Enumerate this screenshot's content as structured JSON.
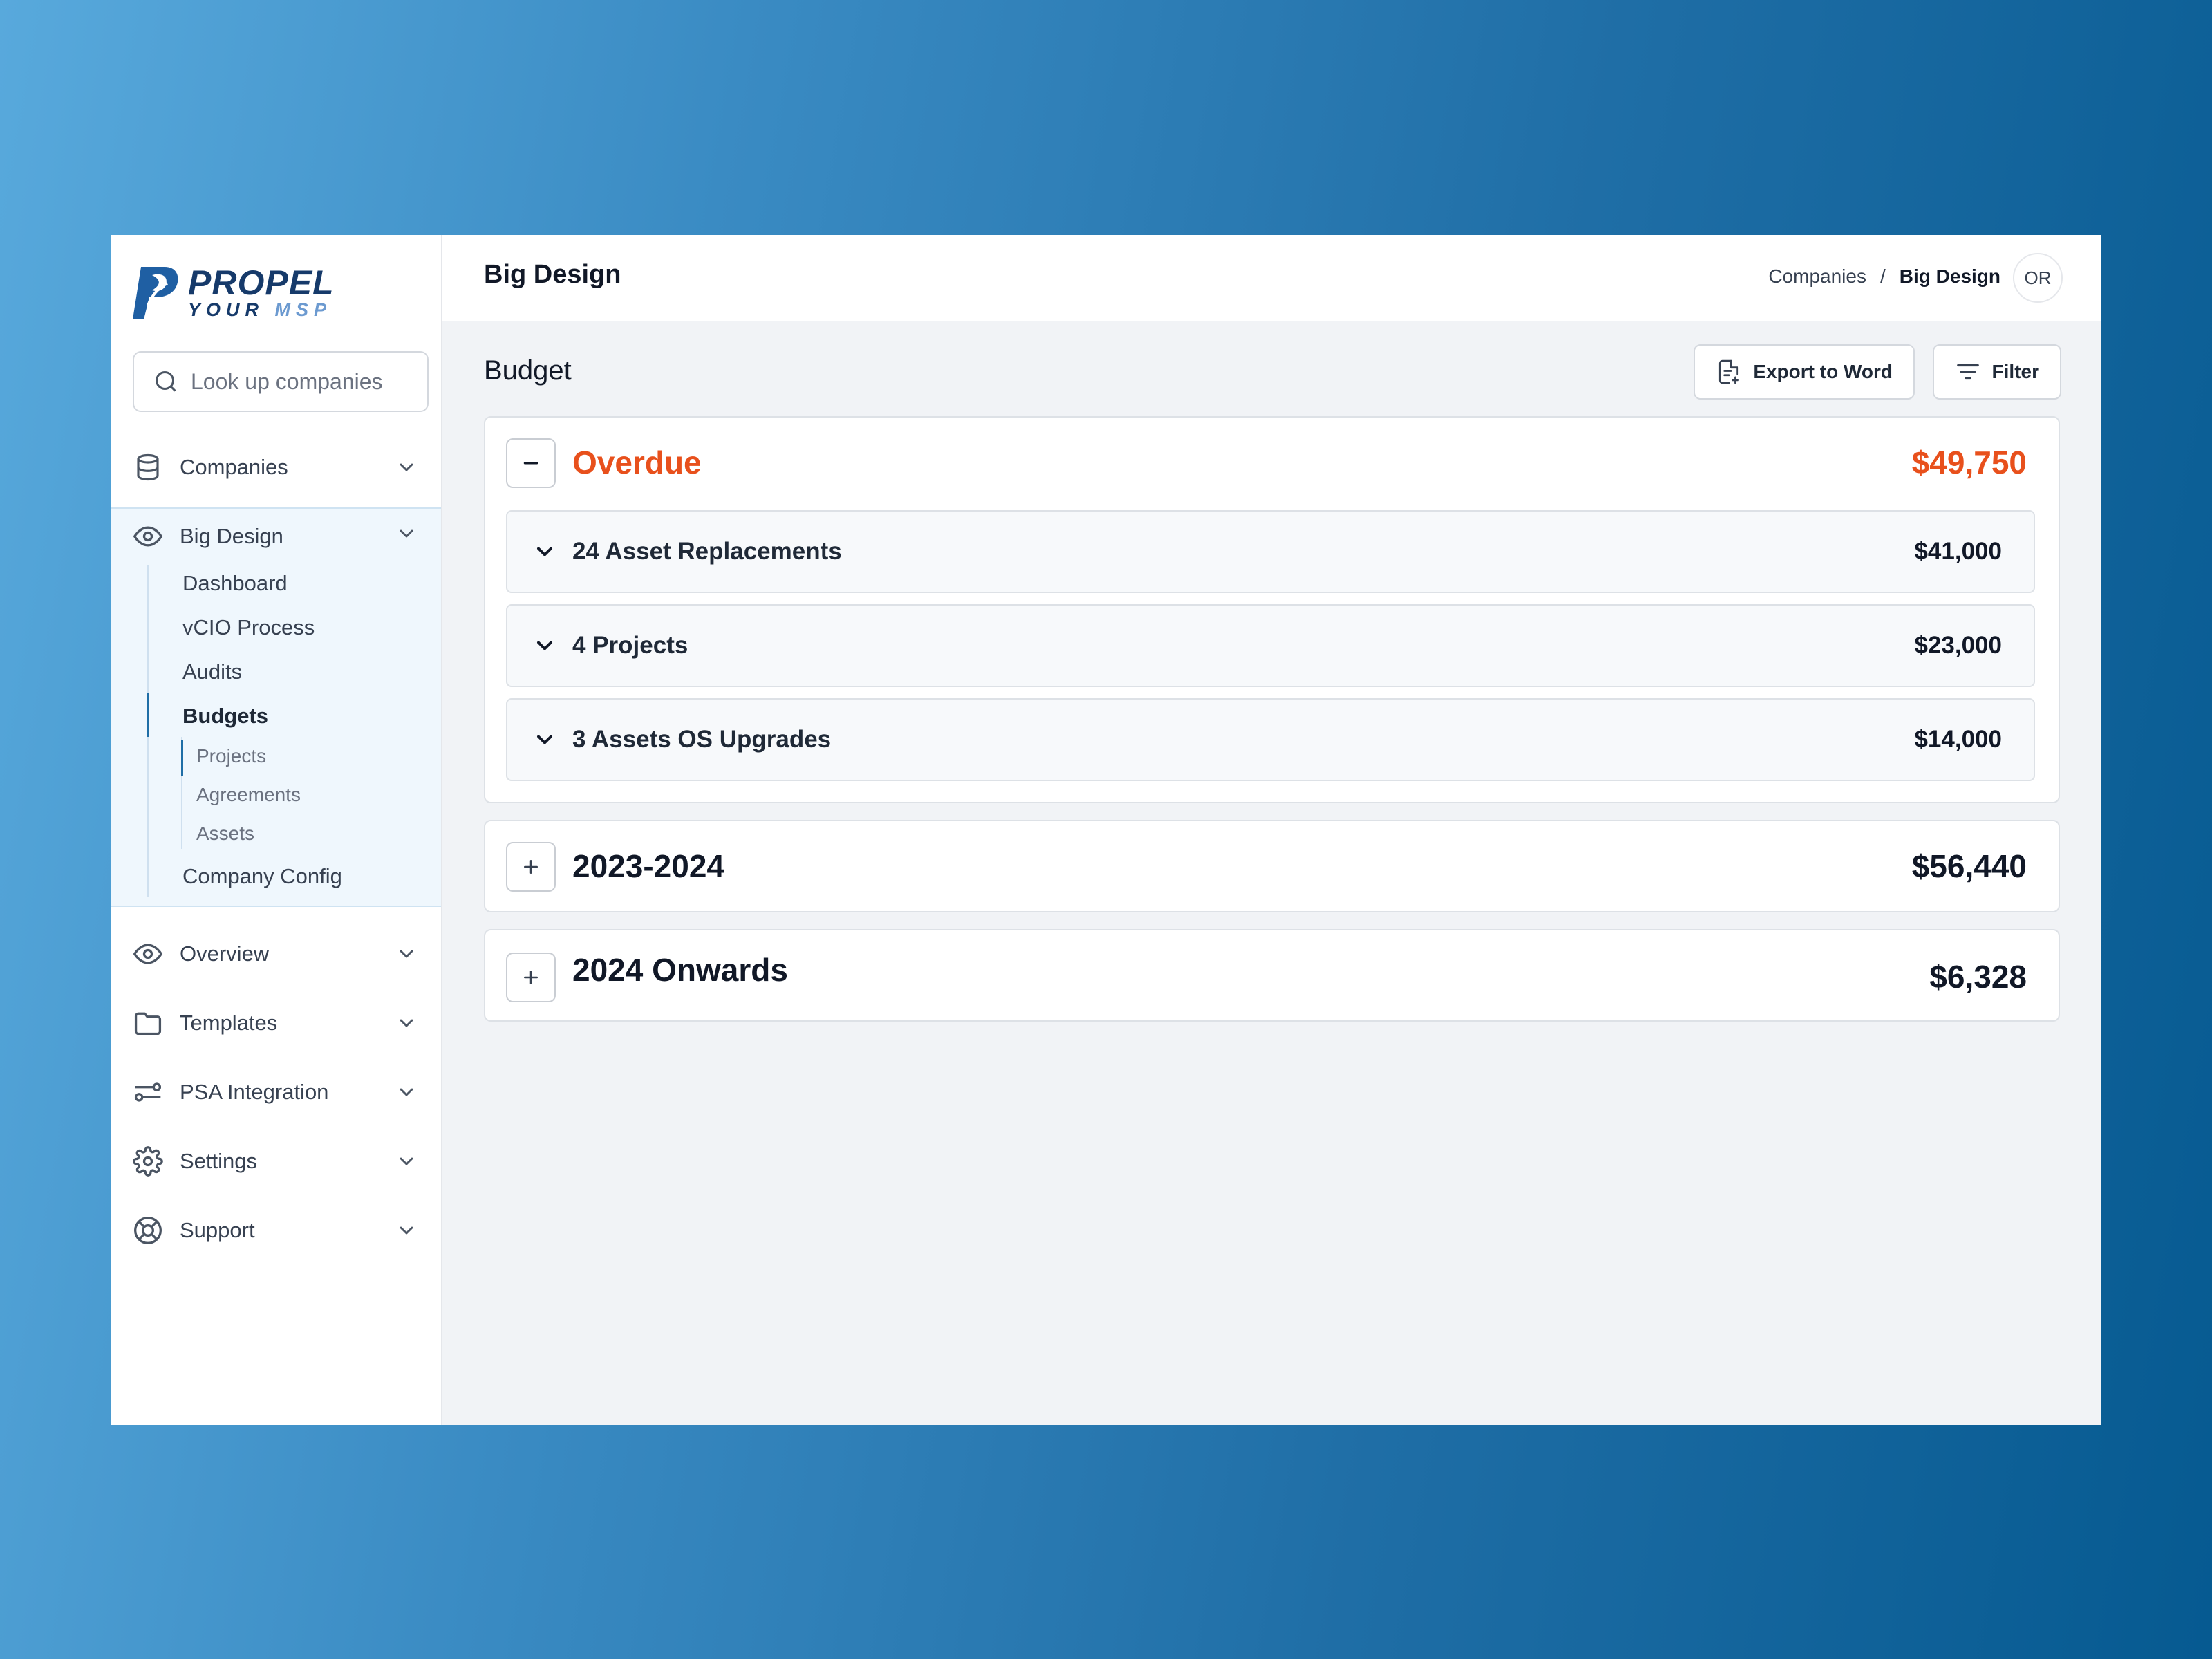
{
  "brand": {
    "line1": "PROPEL",
    "line2a": "YOUR",
    "line2b": "MSP"
  },
  "sidebar": {
    "search_placeholder": "Look up companies",
    "companies": "Companies",
    "big_design": "Big Design",
    "sub": [
      "Dashboard",
      "vCIO Process",
      "Audits",
      "Budgets",
      "Company Config"
    ],
    "budgets_sub": [
      "Projects",
      "Agreements",
      "Assets"
    ],
    "items": [
      "Overview",
      "Templates",
      "PSA Integration",
      "Settings",
      "Support"
    ]
  },
  "header": {
    "title": "Big Design",
    "breadcrumb": [
      "Companies",
      "/",
      "Big Design"
    ],
    "avatar": "OR"
  },
  "budget": {
    "title": "Budget",
    "export_label": "Export to Word",
    "filter_label": "Filter",
    "overdue": {
      "title": "Overdue",
      "amount": "$49,750",
      "rows": [
        {
          "label": "24 Asset Replacements",
          "amount": "$41,000"
        },
        {
          "label": "4 Projects",
          "amount": "$23,000"
        },
        {
          "label": "3 Assets OS Upgrades",
          "amount": "$14,000"
        }
      ]
    },
    "y2023": {
      "title": "2023-2024",
      "amount": "$56,440"
    },
    "y2024": {
      "title": "2024 Onwards",
      "amount": "$6,328"
    }
  },
  "colors": {
    "accent": "#1f6ea6",
    "overdue": "#e8501c"
  }
}
